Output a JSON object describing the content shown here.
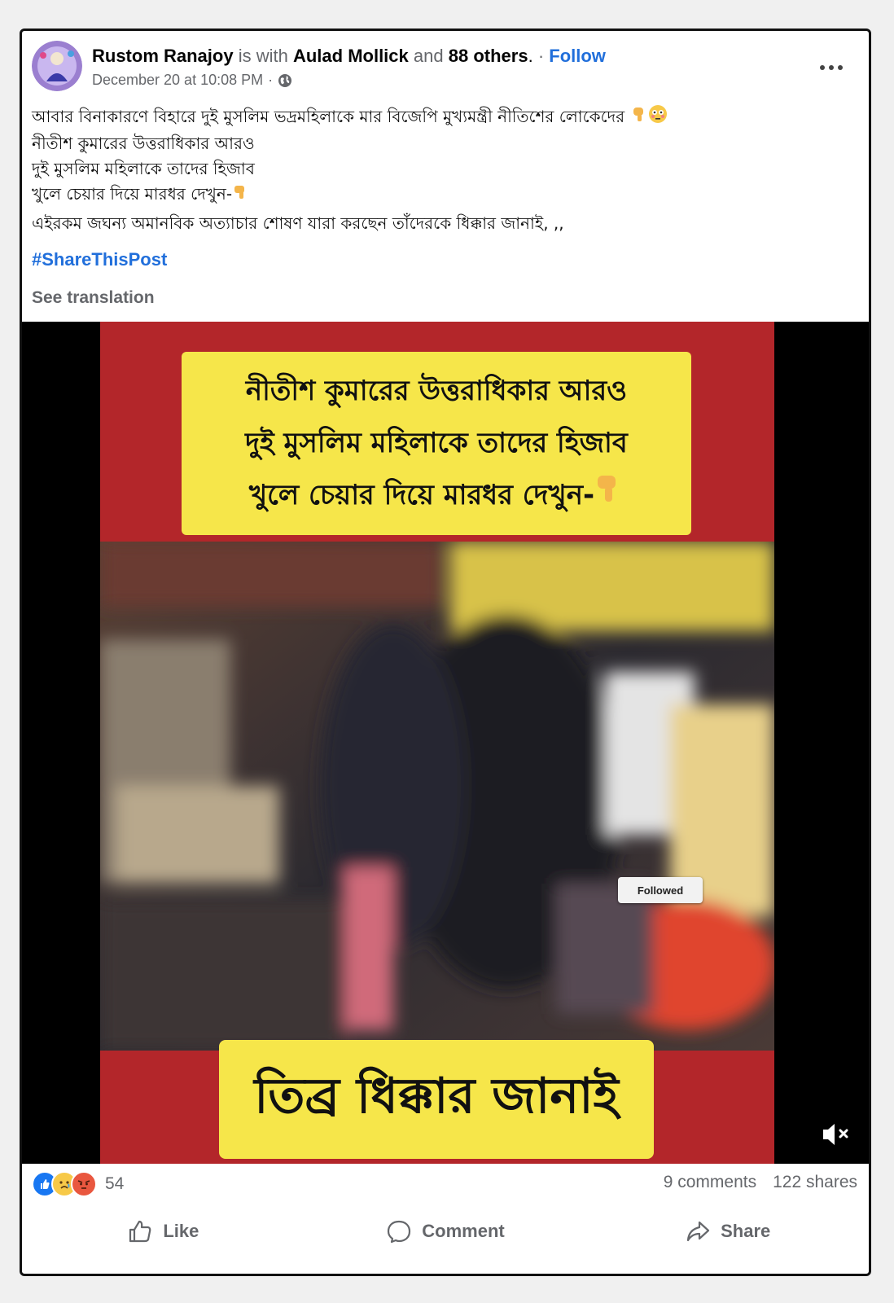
{
  "post": {
    "author": "Rustom Ranajoy",
    "with_text": "is with",
    "tagged": "Aulad Mollick",
    "and_text": "and",
    "others": "88 others",
    "period": ".",
    "separator": "·",
    "follow_label": "Follow",
    "date": "December 20 at 10:08 PM",
    "date_separator": "·",
    "privacy_icon": "globe-icon",
    "body_lines": [
      "আবার বিনাকারণে বিহারে দুই মুসলিম ভদ্রমহিলাকে মার বিজেপি মুখ্যমন্ত্রী নীতিশের লোকেদের",
      "নীতীশ কুমারের উত্তরাধিকার আরও",
      "দুই মুসলিম মহিলাকে তাদের হিজাব",
      "  খুলে চেয়ার দিয়ে মারধর দেখুন-",
      "এইরকম জঘন্য অমানবিক অত্যাচার শোষণ যারা করছেন তাঁদেরকে ধিক্কার জানাই, ,,"
    ],
    "hashtag": "#ShareThisPost",
    "see_translation": "See translation"
  },
  "video": {
    "top_caption": [
      "নীতীশ কুমারের উত্তরাধিকার আরও",
      "দুই মুসলিম মহিলাকে তাদের হিজাব",
      "খুলে চেয়ার দিয়ে মারধর দেখুন-"
    ],
    "bottom_caption": "তিব্র ধিক্কার জানাই",
    "followed_badge": "Followed",
    "mute_icon": "volume-muted-icon"
  },
  "engagement": {
    "reaction_count": "54",
    "comments": "9 comments",
    "shares": "122 shares"
  },
  "actions": {
    "like": "Like",
    "comment": "Comment",
    "share": "Share"
  },
  "colors": {
    "link_blue": "#216fdb",
    "muted_gray": "#65676b",
    "video_red": "#b3262a",
    "caption_yellow": "#f6e64a"
  }
}
